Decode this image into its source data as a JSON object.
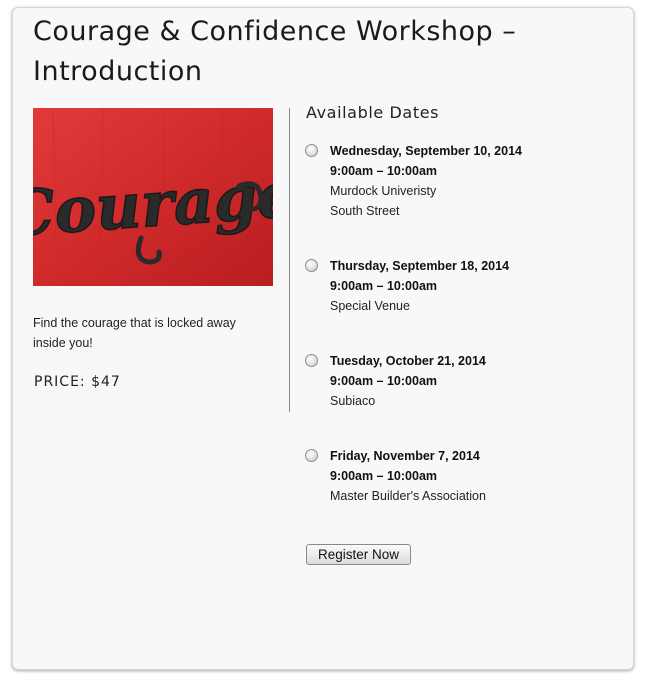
{
  "page": {
    "title": "Courage & Confidence Workshop – Introduction",
    "description": "Find the courage that is locked away inside you!",
    "price": "PRICE: $47"
  },
  "hero": {
    "logo_text": "Courage",
    "colors": {
      "background": "#d62d2d",
      "lettering": "#2a2a2a"
    }
  },
  "dates": {
    "heading": "Available Dates",
    "options": [
      {
        "date": "Wednesday, September 10, 2014",
        "time": "9:00am – 10:00am",
        "venue": [
          "Murdock Univeristy",
          "South Street"
        ],
        "selected": false
      },
      {
        "date": "Thursday, September 18, 2014",
        "time": "9:00am – 10:00am",
        "venue": [
          "Special Venue"
        ],
        "selected": false
      },
      {
        "date": "Tuesday, October 21, 2014",
        "time": "9:00am – 10:00am",
        "venue": [
          "Subiaco"
        ],
        "selected": false
      },
      {
        "date": "Friday, November 7, 2014",
        "time": "9:00am – 10:00am",
        "venue": [
          "Master Builder's Association"
        ],
        "selected": false
      }
    ]
  },
  "actions": {
    "register_label": "Register Now"
  }
}
